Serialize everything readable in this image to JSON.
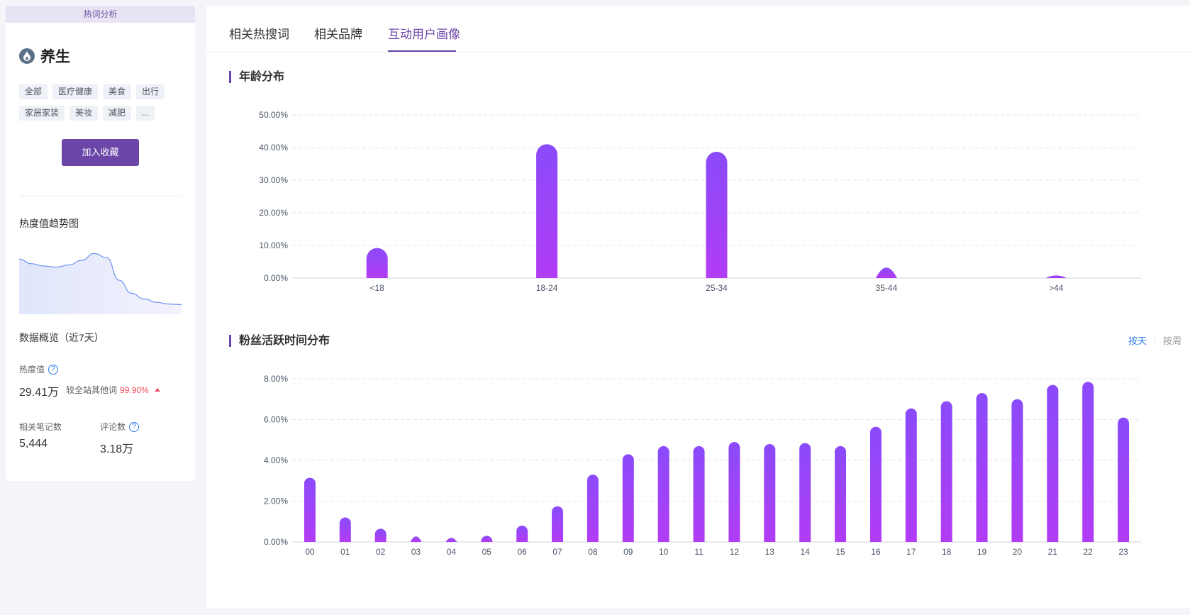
{
  "sidebar": {
    "header": "热词分析",
    "keyword": "养生",
    "tags": [
      "全部",
      "医疗健康",
      "美食",
      "出行",
      "家居家装",
      "美妆",
      "减肥",
      "..."
    ],
    "favorite_label": "加入收藏",
    "trend_title": "热度值趋势图",
    "overview_title": "数据概览（近7天）",
    "heat_label": "热度值",
    "heat_value": "29.41万",
    "compare_label": "较全站其他词",
    "compare_pct": "99.90%",
    "notes_label": "相关笔记数",
    "notes_value": "5,444",
    "comments_label": "评论数",
    "comments_value": "3.18万",
    "trend_line": [
      0.82,
      0.74,
      0.7,
      0.68,
      0.72,
      0.8,
      0.92,
      0.85,
      0.45,
      0.22,
      0.12,
      0.06,
      0.03,
      0.02
    ]
  },
  "tabs": [
    "相关热搜词",
    "相关品牌",
    "互动用户画像"
  ],
  "sections": {
    "age_title": "年龄分布",
    "time_title": "粉丝活跃时间分布",
    "toggle_day": "按天",
    "toggle_week": "按周"
  },
  "colors": {
    "accent": "#6b46a8",
    "bar_top": "#8a4bfa",
    "bar_bottom": "#b23cf5",
    "link": "#2f7be8",
    "up": "#f24b5c"
  },
  "chart_data": [
    {
      "type": "bar",
      "title": "年龄分布",
      "categories": [
        "<18",
        "18-24",
        "25-34",
        "35-44",
        ">44"
      ],
      "values": [
        9.2,
        41.0,
        38.7,
        3.2,
        0.8
      ],
      "ylim": [
        0,
        50
      ],
      "yticks": [
        "0.00%",
        "10.00%",
        "20.00%",
        "30.00%",
        "40.00%",
        "50.00%"
      ],
      "grid": true
    },
    {
      "type": "bar",
      "title": "粉丝活跃时间分布",
      "categories": [
        "00",
        "01",
        "02",
        "03",
        "04",
        "05",
        "06",
        "07",
        "08",
        "09",
        "10",
        "11",
        "12",
        "13",
        "14",
        "15",
        "16",
        "17",
        "18",
        "19",
        "20",
        "21",
        "22",
        "23"
      ],
      "values": [
        3.15,
        1.2,
        0.65,
        0.27,
        0.2,
        0.3,
        0.8,
        1.75,
        3.3,
        4.3,
        4.7,
        4.7,
        4.9,
        4.8,
        4.85,
        4.7,
        5.65,
        6.55,
        6.9,
        7.3,
        7.0,
        7.7,
        7.85,
        6.1
      ],
      "ylim": [
        0,
        8
      ],
      "yticks": [
        "0.00%",
        "2.00%",
        "4.00%",
        "6.00%",
        "8.00%"
      ],
      "grid": true
    }
  ]
}
